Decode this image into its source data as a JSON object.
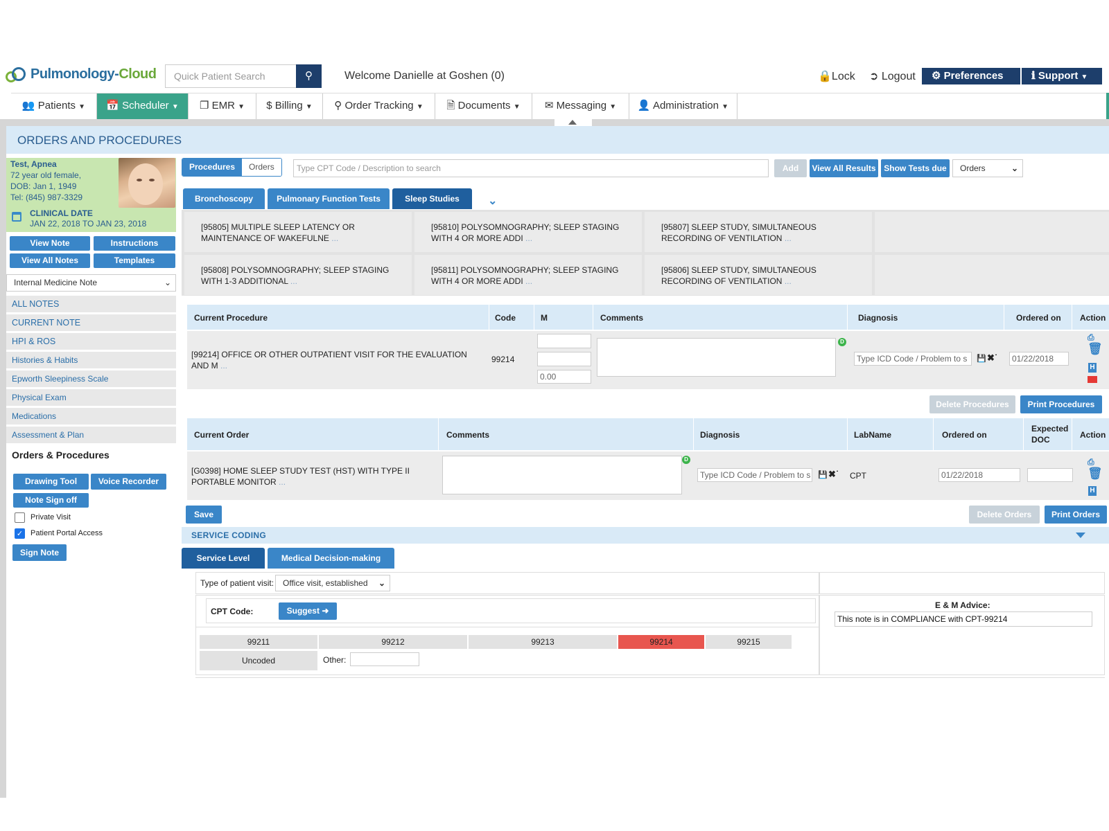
{
  "header": {
    "logo_part1": "Pulmonology-",
    "logo_part2": "Cloud",
    "search_placeholder": "Quick Patient Search",
    "welcome": "Welcome Danielle at Goshen (0)",
    "lock": "Lock",
    "logout": "Logout",
    "preferences": "Preferences",
    "support": "Support"
  },
  "nav": [
    {
      "label": "Patients",
      "icon": "users-icon"
    },
    {
      "label": "Scheduler",
      "icon": "calendar-icon"
    },
    {
      "label": "EMR",
      "icon": "copy-icon"
    },
    {
      "label": "Billing",
      "icon": "dollar-icon"
    },
    {
      "label": "Order Tracking",
      "icon": "search-icon"
    },
    {
      "label": "Documents",
      "icon": "document-icon"
    },
    {
      "label": "Messaging",
      "icon": "envelope-icon"
    },
    {
      "label": "Administration",
      "icon": "user-icon"
    }
  ],
  "page_title": "ORDERS AND PROCEDURES",
  "patient": {
    "name": "Test, Apnea",
    "age_sex": "72 year old female,",
    "dob": "DOB: Jan 1, 1949",
    "tel": "Tel: (845) 987-3329",
    "clinical_date_label": "CLINICAL DATE",
    "clinical_dates": "JAN 22, 2018 TO JAN 23, 2018"
  },
  "sidebar": {
    "view_note": "View Note",
    "instructions": "Instructions",
    "view_all_notes": "View All Notes",
    "templates": "Templates",
    "note_type": "Internal Medicine Note",
    "items": [
      "ALL NOTES",
      "CURRENT NOTE",
      "HPI & ROS",
      "Histories & Habits",
      "Epworth Sleepiness Scale",
      "Physical Exam",
      "Medications",
      "Assessment & Plan"
    ],
    "active_item": "Orders & Procedures",
    "drawing_tool": "Drawing Tool",
    "voice_recorder": "Voice Recorder",
    "note_sign_off": "Note Sign off",
    "private_visit": "Private Visit",
    "private_visit_checked": false,
    "patient_portal_access": "Patient Portal Access",
    "patient_portal_checked": true,
    "sign_note": "Sign Note"
  },
  "main": {
    "seg_procedures": "Procedures",
    "seg_orders": "Orders",
    "cpt_placeholder": "Type CPT Code / Description to search",
    "add": "Add",
    "view_all_results": "View All Results",
    "show_tests_due": "Show Tests due",
    "orders_select": "Orders",
    "tabs": [
      "Bronchoscopy",
      "Pulmonary Function Tests",
      "Sleep Studies"
    ],
    "active_tab": "Sleep Studies",
    "grid": [
      {
        "text": "[95805] MULTIPLE SLEEP LATENCY OR MAINTENANCE OF WAKEFULNE",
        "more": "..."
      },
      {
        "text": "[95810] POLYSOMNOGRAPHY; SLEEP STAGING WITH 4 OR MORE ADDI",
        "more": "..."
      },
      {
        "text": "[95807] SLEEP STUDY, SIMULTANEOUS RECORDING OF VENTILATION",
        "more": "..."
      },
      {
        "text": "[95808] POLYSOMNOGRAPHY; SLEEP STAGING WITH 1-3 ADDITIONAL",
        "more": "..."
      },
      {
        "text": "[95811] POLYSOMNOGRAPHY; SLEEP STAGING WITH 4 OR MORE ADDI",
        "more": "..."
      },
      {
        "text": "[95806] SLEEP STUDY, SIMULTANEOUS RECORDING OF VENTILATION",
        "more": "..."
      }
    ],
    "proc_headers": {
      "procedure": "Current Procedure",
      "code": "Code",
      "m": "M",
      "comments": "Comments",
      "diagnosis": "Diagnosis",
      "ordered_on": "Ordered on",
      "action": "Action"
    },
    "proc_row": {
      "text": "[99214] OFFICE OR OTHER OUTPATIENT VISIT FOR THE EVALUATION AND M",
      "more": "...",
      "code": "99214",
      "m3": "0.00",
      "dx_placeholder": "Type ICD Code / Problem to s",
      "ordered_on": "01/22/2018",
      "dot": "D"
    },
    "delete_procedures": "Delete Procedures",
    "print_procedures": "Print Procedures",
    "order_headers": {
      "order": "Current Order",
      "comments": "Comments",
      "diagnosis": "Diagnosis",
      "labname": "LabName",
      "ordered_on": "Ordered on",
      "expected": "Expected",
      "doc": "DOC",
      "action": "Action"
    },
    "order_row": {
      "text": "[G0398] HOME SLEEP STUDY TEST (HST) WITH TYPE II PORTABLE MONITOR",
      "more": "...",
      "dx_placeholder": "Type ICD Code / Problem to s",
      "labname": "CPT",
      "ordered_on": "01/22/2018",
      "dot": "D"
    },
    "save": "Save",
    "delete_orders": "Delete Orders",
    "print_orders": "Print Orders"
  },
  "service_coding": {
    "title": "SERVICE CODING",
    "tab_service_level": "Service Level",
    "tab_mdm": "Medical Decision-making",
    "visit_type_label": "Type of patient visit:",
    "visit_type_value": "Office visit, established",
    "cpt_label": "CPT Code:",
    "suggest": "Suggest",
    "codes": [
      "99211",
      "99212",
      "99213",
      "99214",
      "99215"
    ],
    "selected_code": "99214",
    "uncoded": "Uncoded",
    "other_label": "Other:",
    "em_advice_label": "E & M Advice:",
    "em_advice": "This note is in COMPLIANCE with CPT-99214"
  },
  "colors": {
    "nav_active": "#3aa38a",
    "primary": "#3a86c8",
    "dark": "#1d3e6b",
    "selected_code": "#e8564f"
  }
}
